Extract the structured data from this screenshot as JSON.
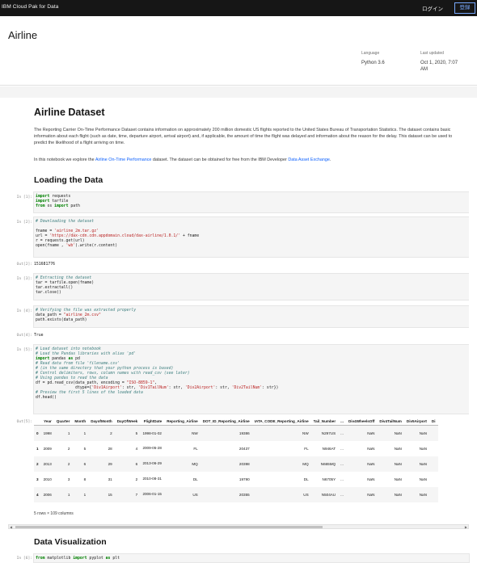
{
  "topbar": {
    "brand": "IBM Cloud Pak for Data",
    "login": "ログイン",
    "signup": "登録"
  },
  "header": {
    "title": "Airline",
    "language_label": "Language",
    "language_value": "Python 3.6",
    "updated_label": "Last updated",
    "updated_value_1": "Oct 1, 2020, 7:07",
    "updated_value_2": "AM"
  },
  "notebook": {
    "title": "Airline Dataset",
    "intro": "The Reporting Carrier On-Time Performance Dataset contains information on approximately 200 million domestic US flights reported to the United States Bureau of Transportation Statistics. The dataset contains basic information about each flight (such as date, time, departure airport, arrival airport) and, if applicable, the amount of time the flight was delayed and information about the reason for the delay. This dataset can be used to predict the likelihood of a flight arriving on time.",
    "explore_prefix": "In this notebook we explore the ",
    "explore_link1": "Airline On-Time Performance",
    "explore_middle": " dataset. The dataset can be obtained for free from the IBM Developer ",
    "explore_link2": "Data Asset Exchange",
    "explore_suffix": ".",
    "section_loading": "Loading the Data",
    "section_viz": "Data Visualization",
    "prompts": {
      "in1": "In [1]:",
      "in2": "In [2]:",
      "out2": "Out[2]:",
      "in3": "In [3]:",
      "in4": "In [4]:",
      "out4": "Out[4]:",
      "in5": "In [5]:",
      "out5": "Out[5]:",
      "in6": "In [6]:"
    },
    "cell1": [
      "import requests",
      "import tarfile",
      "from os import path"
    ],
    "cell2": [
      "# Downloading the dataset",
      "",
      "fname = 'airline_2m.tar.gz'",
      "url = 'https://dax-cdn.cdn.appdomain.cloud/dax-airline/1.0.1/' + fname",
      "r = requests.get(url)",
      "open(fname , 'wb').write(r.content)"
    ],
    "out2": "151681776",
    "cell3": [
      "# Extracting the dataset",
      "tar = tarfile.open(fname)",
      "tar.extractall()",
      "tar.close()"
    ],
    "cell4": [
      "# Verifying the file was extracted properly",
      "data_path = \"airline_2m.csv\"",
      "path.exists(data_path)"
    ],
    "out4": "True",
    "cell5": [
      "# Load dataset into notebook",
      "# Load the Pandas libraries with alias 'pd'",
      "import pandas as pd",
      "# Read data from file 'filename.csv'",
      "# (in the same directory that your python process is based)",
      "# Control delimiters, rows, column names with read_csv (see later)",
      "# Using pandas to read the data",
      "df = pd.read_csv(data_path, encoding = \"ISO-8859-1\",",
      "                 dtype={'Div1Airport': str, 'Div1TailNum': str, 'Div2Airport': str, 'Div2TailNum': str})",
      "# Preview the first 5 lines of the loaded data",
      "df.head()"
    ],
    "cell6": "from matplotlib import pyplot as plt",
    "table": {
      "columns": [
        "",
        "Year",
        "Quarter",
        "Month",
        "DayofMonth",
        "DayOfWeek",
        "FlightDate",
        "Reporting_Airline",
        "DOT_ID_Reporting_Airline",
        "IATA_CODE_Reporting_Airline",
        "Tail_Number",
        "...",
        "Div4WheelsOff",
        "Div4TailNum",
        "Div5Airport",
        "Di"
      ],
      "rows": [
        [
          "0",
          "1998",
          "1",
          "1",
          "2",
          "5",
          "1998-01-02",
          "NW",
          "19386",
          "NW",
          "N297US",
          "...",
          "NaN",
          "NaN",
          "NaN",
          ""
        ],
        [
          "1",
          "2009",
          "2",
          "5",
          "28",
          "4",
          "2009-05-28",
          "FL",
          "20437",
          "FL",
          "N946AT",
          "...",
          "NaN",
          "NaN",
          "NaN",
          ""
        ],
        [
          "2",
          "2013",
          "2",
          "6",
          "29",
          "6",
          "2013-06-29",
          "MQ",
          "20398",
          "MQ",
          "N665MQ",
          "...",
          "NaN",
          "NaN",
          "NaN",
          ""
        ],
        [
          "3",
          "2010",
          "3",
          "8",
          "31",
          "2",
          "2010-08-31",
          "DL",
          "19790",
          "DL",
          "N6705Y",
          "...",
          "NaN",
          "NaN",
          "NaN",
          ""
        ],
        [
          "4",
          "2006",
          "1",
          "1",
          "15",
          "7",
          "2006-01-15",
          "US",
          "20355",
          "US",
          "N504AU",
          "...",
          "NaN",
          "NaN",
          "NaN",
          ""
        ]
      ],
      "shape_text": "5 rows × 109 columns"
    }
  }
}
